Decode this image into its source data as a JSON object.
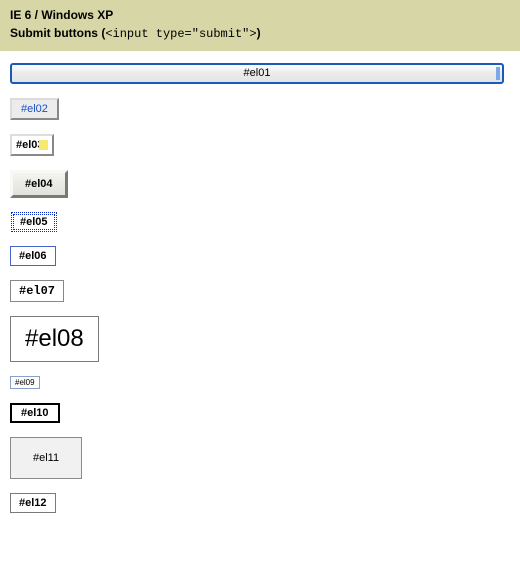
{
  "header": {
    "title": "IE 6 / Windows XP",
    "subtitle_prefix": "Submit buttons (",
    "subtitle_code": "<input type=\"submit\">",
    "subtitle_suffix": ")"
  },
  "buttons": {
    "el01": "#el01",
    "el02": "#el02",
    "el03": "#el03",
    "el04": "#el04",
    "el05": "#el05",
    "el06": "#el06",
    "el07": "#el07",
    "el08": "#el08",
    "el09": "#el09",
    "el10": "#el10",
    "el11": "#el11",
    "el12": "#el12"
  }
}
